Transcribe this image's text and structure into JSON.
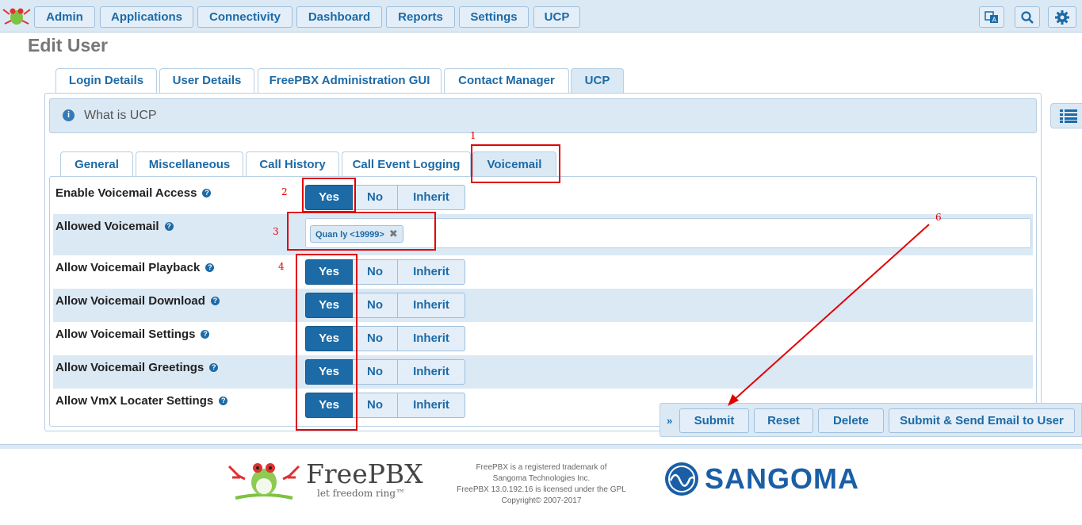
{
  "nav": {
    "items": [
      "Admin",
      "Applications",
      "Connectivity",
      "Dashboard",
      "Reports",
      "Settings",
      "UCP"
    ],
    "icons": [
      "language-icon",
      "search-icon",
      "gear-icon"
    ]
  },
  "page_title": "Edit User",
  "outer_tabs": [
    "Login Details",
    "User Details",
    "FreePBX Administration GUI",
    "Contact Manager",
    "UCP"
  ],
  "outer_tab_active": "UCP",
  "whatis_label": "What is UCP",
  "inner_tabs": [
    "General",
    "Miscellaneous",
    "Call History",
    "Call Event Logging",
    "Voicemail"
  ],
  "inner_tab_active": "Voicemail",
  "toggle_options": {
    "yes": "Yes",
    "no": "No",
    "inherit": "Inherit"
  },
  "settings": [
    {
      "label": "Enable Voicemail Access",
      "value": "Yes"
    },
    {
      "label": "Allowed Voicemail",
      "chip": "Quan ly <19999>"
    },
    {
      "label": "Allow Voicemail Playback",
      "value": "Yes"
    },
    {
      "label": "Allow Voicemail Download",
      "value": "Yes"
    },
    {
      "label": "Allow Voicemail Settings",
      "value": "Yes"
    },
    {
      "label": "Allow Voicemail Greetings",
      "value": "Yes"
    },
    {
      "label": "Allow VmX Locater Settings",
      "value": "Yes"
    }
  ],
  "annotations": [
    "1",
    "2",
    "3",
    "4",
    "6"
  ],
  "annotation_color": "#e10000",
  "actions": [
    "Submit",
    "Reset",
    "Delete",
    "Submit & Send Email to User"
  ],
  "footer": {
    "freepbx_name": "FreePBX",
    "freepbx_tagline": "let freedom ring™",
    "lines": [
      "FreePBX is a registered trademark of",
      "Sangoma Technologies Inc.",
      "FreePBX 13.0.192.16 is licensed under the GPL",
      "Copyright© 2007-2017"
    ],
    "sangoma_name": "SANGOMA"
  },
  "colors": {
    "accent": "#1c6aa6",
    "panel_bg": "#dbe9f5",
    "border": "#b7cfe4"
  }
}
